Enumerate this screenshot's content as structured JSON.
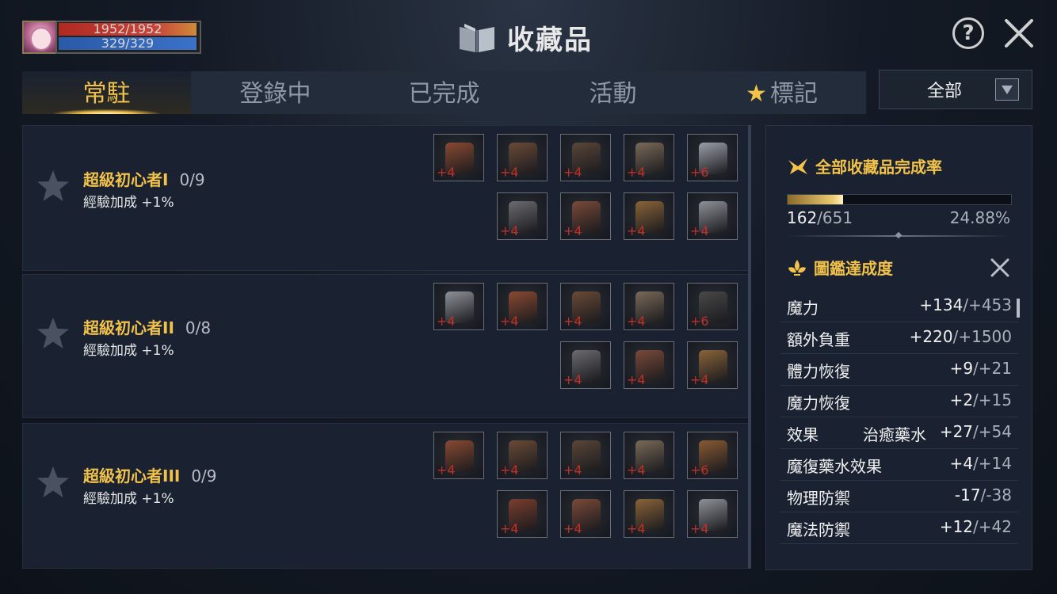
{
  "player": {
    "hp": "1952/1952",
    "mp": "329/329"
  },
  "header": {
    "title": "收藏品",
    "help_label": "?"
  },
  "tabs": [
    {
      "label": "常駐",
      "active": true
    },
    {
      "label": "登錄中",
      "active": false
    },
    {
      "label": "已完成",
      "active": false
    },
    {
      "label": "活動",
      "active": false
    },
    {
      "label": "標記",
      "active": false,
      "icon": "star-icon"
    }
  ],
  "filter": {
    "selected": "全部"
  },
  "collections": [
    {
      "name": "超級初心者I",
      "count": "0/9",
      "bonus": "經驗加成 +1%",
      "items": [
        {
          "icon": "glove-icon",
          "level": "+4"
        },
        {
          "icon": "cloak-icon",
          "level": "+4"
        },
        {
          "icon": "shield-icon",
          "level": "+4"
        },
        {
          "icon": "horned-helmet-icon",
          "level": "+4"
        },
        {
          "icon": "sword-icon",
          "level": "+6"
        },
        {
          "icon": "armor-icon",
          "level": "+4"
        },
        {
          "icon": "boots-icon",
          "level": "+4"
        },
        {
          "icon": "pants-icon",
          "level": "+4"
        },
        {
          "icon": "robe-icon",
          "level": "+4"
        }
      ]
    },
    {
      "name": "超級初心者II",
      "count": "0/8",
      "bonus": "經驗加成 +1%",
      "items": [
        {
          "icon": "robe-icon",
          "level": "+4"
        },
        {
          "icon": "glove-icon",
          "level": "+4"
        },
        {
          "icon": "cloak-icon",
          "level": "+4"
        },
        {
          "icon": "horned-helmet-icon",
          "level": "+4"
        },
        {
          "icon": "bow-icon",
          "level": "+6"
        },
        {
          "icon": "armor-icon",
          "level": "+4"
        },
        {
          "icon": "boots-icon",
          "level": "+4"
        },
        {
          "icon": "pants-icon",
          "level": "+4"
        }
      ]
    },
    {
      "name": "超級初心者III",
      "count": "0/9",
      "bonus": "經驗加成 +1%",
      "items": [
        {
          "icon": "glove-icon",
          "level": "+4"
        },
        {
          "icon": "cloak-icon",
          "level": "+4"
        },
        {
          "icon": "shield-icon",
          "level": "+4"
        },
        {
          "icon": "horned-helmet-icon",
          "level": "+4"
        },
        {
          "icon": "staff-icon",
          "level": "+6"
        },
        {
          "icon": "cape-icon",
          "level": "+4"
        },
        {
          "icon": "boots-icon",
          "level": "+4"
        },
        {
          "icon": "pants-icon",
          "level": "+4"
        },
        {
          "icon": "robe-icon",
          "level": "+4"
        }
      ]
    }
  ],
  "summary": {
    "completion_title": "全部收藏品完成率",
    "completed": "162",
    "total": "/651",
    "percent": "24.88%",
    "progress_fraction": 0.2488,
    "stats_title": "圖鑑達成度",
    "stats": [
      {
        "name": "魔力",
        "detail": "",
        "current": "+134",
        "max": "/+453"
      },
      {
        "name": "額外負重",
        "detail": "",
        "current": "+220",
        "max": "/+1500"
      },
      {
        "name": "體力恢復",
        "detail": "",
        "current": "+9",
        "max": "/+21"
      },
      {
        "name": "魔力恢復",
        "detail": "",
        "current": "+2",
        "max": "/+15"
      },
      {
        "name": "效果",
        "detail": "治癒藥水",
        "current": "+27",
        "max": "/+54"
      },
      {
        "name": "魔復藥水效果",
        "detail": "",
        "current": "+4",
        "max": "/+14"
      },
      {
        "name": "物理防禦",
        "detail": "",
        "current": "-17",
        "max": "/-38"
      },
      {
        "name": "魔法防禦",
        "detail": "",
        "current": "+12",
        "max": "/+42"
      }
    ]
  },
  "colors": {
    "accent_gold": "#f2c24a",
    "plus_red": "#c0302a",
    "panel_bg": "#1a2231"
  }
}
